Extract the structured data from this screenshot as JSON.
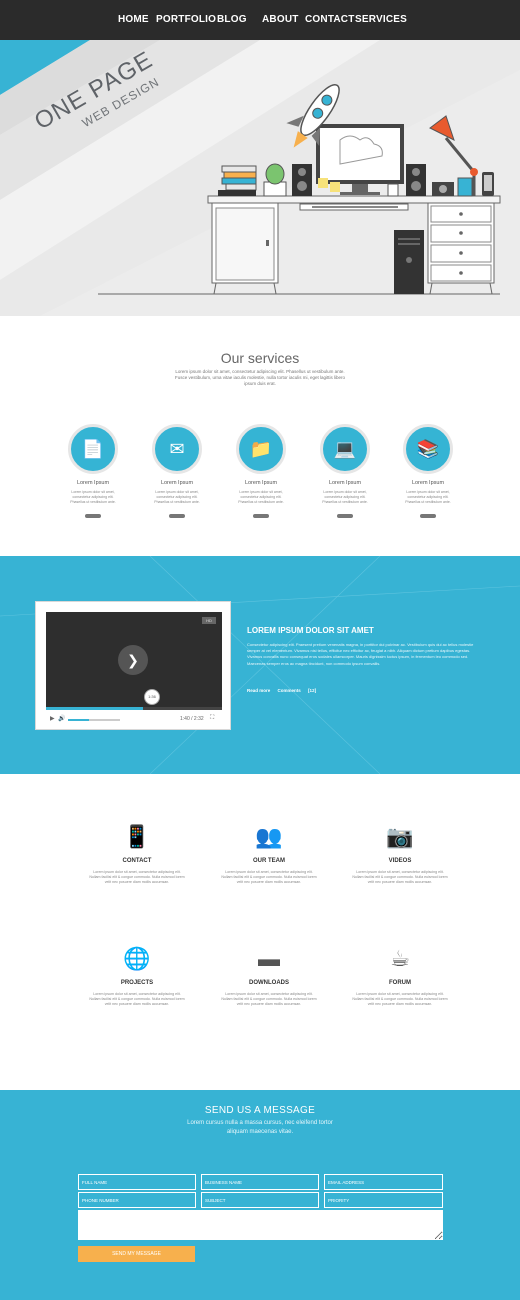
{
  "nav": {
    "items": [
      {
        "label": "HOME"
      },
      {
        "label": "PORTFOLIO"
      },
      {
        "label": "BLOG"
      },
      {
        "label": "ABOUT"
      },
      {
        "label": "CONTACT"
      },
      {
        "label": "SERVICES"
      }
    ]
  },
  "hero": {
    "title": "ONE PAGE",
    "subtitle": "WEB DESIGN"
  },
  "services": {
    "title": "Our services",
    "description": "Lorem ipsum dolor sit amet, consectetur adipiscing elit. Phasellus ut vestibulum ante. Fusce vestibulum, urna vitae iaculis molestie, nulla tortor iaculis mi, eget lagittis libero ipsum duis erat.",
    "items": [
      {
        "icon": "documents-icon",
        "title": "Lorem Ipsum",
        "text": "Lorem ipsum dolor sit amet, consectetur adipiscing elit. Phasellus ut vestibulum ante."
      },
      {
        "icon": "mail-icon",
        "title": "Lorem Ipsum",
        "text": "Lorem ipsum dolor sit amet, consectetur adipiscing elit. Phasellus ut vestibulum ante."
      },
      {
        "icon": "folder-icon",
        "title": "Lorem Ipsum",
        "text": "Lorem ipsum dolor sit amet, consectetur adipiscing elit. Phasellus ut vestibulum ante."
      },
      {
        "icon": "monitor-icon",
        "title": "Lorem Ipsum",
        "text": "Lorem ipsum dolor sit amet, consectetur adipiscing elit. Phasellus ut vestibulum ante."
      },
      {
        "icon": "books-icon",
        "title": "Lorem Ipsum",
        "text": "Lorem ipsum dolor sit amet, consectetur adipiscing elit. Phasellus ut vestibulum ante."
      }
    ]
  },
  "video": {
    "badge": "HD",
    "thumb_time": "1:36",
    "time": "1:40 / 2:32",
    "progress": 0.55,
    "volume": 0.4,
    "title": "LOREM IPSUM DOLOR SIT AMET",
    "text": "Consectetur adipiscing elit. Praesent pretium venenatis magna, in porttitor dui pulvinar ac. Vestibulum quis dui ac tellus molestie semper at vel elementum. Vivamus nisi tellus, efficitur nec efficitur ac, feugiat a nibh. Aliquam dictum pretium dapibus egestas. Vivamus convallis nunc consequat eros sodales ullamcorper. Mauris dignissim luctus ipsum, in fermentum leo commodo sed. Maecenas semper eros ac magna tincidunt, non commodo ipsum convallis.",
    "read_more": "Read more",
    "comments": "Comments",
    "comments_count": "[12]"
  },
  "features": {
    "items": [
      {
        "icon": "phone-icon",
        "title": "CONTACT",
        "text": "Lorem ipsum dolor sit amet, consectetur adipiscing elit. Nullam facilisi elit & congue commodo. Nulla euismod lorem velit nec posuere diam mollis accumsan."
      },
      {
        "icon": "team-icon",
        "title": "OUR TEAM",
        "text": "Lorem ipsum dolor sit amet, consectetur adipiscing elit. Nullam facilisi elit & congue commodo. Nulla euismod lorem velit nec posuere diam mollis accumsan."
      },
      {
        "icon": "camera-icon",
        "title": "VIDEOS",
        "text": "Lorem ipsum dolor sit amet, consectetur adipiscing elit. Nullam facilisi elit & congue commodo. Nulla euismod lorem velit nec posuere diam mollis accumsan."
      },
      {
        "icon": "globe-icon",
        "title": "PROJECTS",
        "text": "Lorem ipsum dolor sit amet, consectetur adipiscing elit. Nullam facilisi elit & congue commodo. Nulla euismod lorem velit nec posuere diam mollis accumsan."
      },
      {
        "icon": "usb-drive-icon",
        "title": "DOWNLOADS",
        "text": "Lorem ipsum dolor sit amet, consectetur adipiscing elit. Nullam facilisi elit & congue commodo. Nulla euismod lorem velit nec posuere diam mollis accumsan."
      },
      {
        "icon": "coffee-cup-icon",
        "title": "FORUM",
        "text": "Lorem ipsum dolor sit amet, consectetur adipiscing elit. Nullam facilisi elit & congue commodo. Nulla euismod lorem velit nec posuere diam mollis accumsan."
      }
    ]
  },
  "contact": {
    "title": "SEND US A MESSAGE",
    "subtitle_1": "Lorem cursus nulla a massa cursus, nec eleifend tortor",
    "subtitle_2": "aliquam maecenas vitae.",
    "fields": {
      "full_name": "FULL NAME",
      "business_name": "BUSINESS NAME",
      "email": "EMAIL ADDRESS",
      "phone": "PHONE NUMBER",
      "subject": "SUBJECT",
      "priority": "PRIORITY"
    },
    "send_label": "SEND MY MESSAGE"
  },
  "colors": {
    "accent": "#37b3d4",
    "nav_bg": "#2b2b2b",
    "button": "#f7b04d"
  }
}
